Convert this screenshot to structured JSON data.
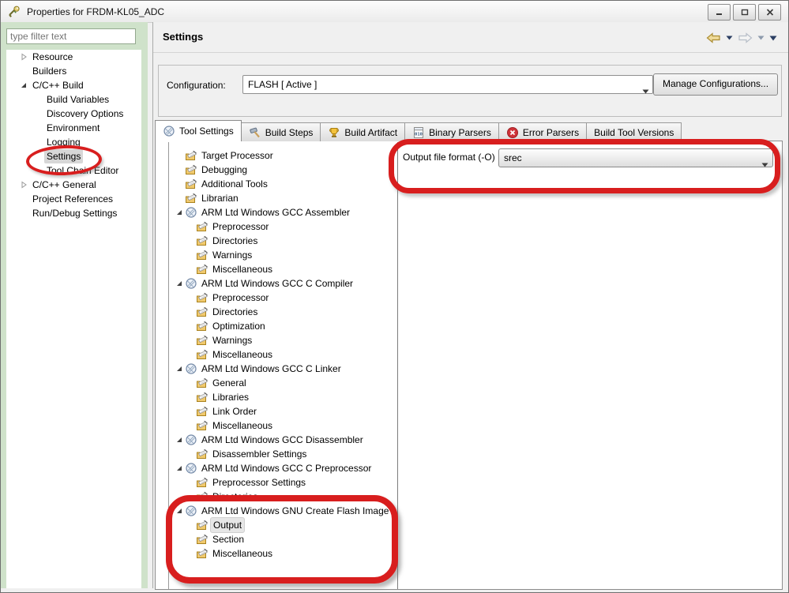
{
  "window": {
    "title": "Properties for FRDM-KL05_ADC"
  },
  "sidebar": {
    "filter_placeholder": "type filter text",
    "items": [
      {
        "label": "Resource",
        "level": 0,
        "arrow": "collapsed"
      },
      {
        "label": "Builders",
        "level": 0,
        "arrow": "none"
      },
      {
        "label": "C/C++ Build",
        "level": 0,
        "arrow": "expanded"
      },
      {
        "label": "Build Variables",
        "level": 1,
        "arrow": "none"
      },
      {
        "label": "Discovery Options",
        "level": 1,
        "arrow": "none"
      },
      {
        "label": "Environment",
        "level": 1,
        "arrow": "none"
      },
      {
        "label": "Logging",
        "level": 1,
        "arrow": "none"
      },
      {
        "label": "Settings",
        "level": 1,
        "arrow": "none",
        "selected": true
      },
      {
        "label": "Tool Chain Editor",
        "level": 1,
        "arrow": "none"
      },
      {
        "label": "C/C++ General",
        "level": 0,
        "arrow": "collapsed"
      },
      {
        "label": "Project References",
        "level": 0,
        "arrow": "none"
      },
      {
        "label": "Run/Debug Settings",
        "level": 0,
        "arrow": "none"
      }
    ]
  },
  "header": {
    "title": "Settings"
  },
  "config": {
    "label": "Configuration:",
    "value": "FLASH  [ Active ]",
    "manage_button": "Manage Configurations..."
  },
  "tabs": [
    {
      "label": "Tool Settings",
      "icon": "tool",
      "active": true
    },
    {
      "label": "Build Steps",
      "icon": "hammer",
      "active": false
    },
    {
      "label": "Build Artifact",
      "icon": "trophy",
      "active": false
    },
    {
      "label": "Binary Parsers",
      "icon": "binary",
      "active": false
    },
    {
      "label": "Error Parsers",
      "icon": "error",
      "active": false
    },
    {
      "label": "Build Tool Versions",
      "icon": "none",
      "active": false
    }
  ],
  "tool_tree": [
    {
      "label": "Target Processor",
      "icon": "category",
      "level": 0,
      "arrow": "none"
    },
    {
      "label": "Debugging",
      "icon": "category",
      "level": 0,
      "arrow": "none"
    },
    {
      "label": "Additional Tools",
      "icon": "category",
      "level": 0,
      "arrow": "none"
    },
    {
      "label": "Librarian",
      "icon": "category",
      "level": 0,
      "arrow": "none"
    },
    {
      "label": "ARM Ltd Windows GCC Assembler",
      "icon": "tool",
      "level": 0,
      "arrow": "expanded"
    },
    {
      "label": "Preprocessor",
      "icon": "category",
      "level": 1,
      "arrow": "none"
    },
    {
      "label": "Directories",
      "icon": "category",
      "level": 1,
      "arrow": "none"
    },
    {
      "label": "Warnings",
      "icon": "category",
      "level": 1,
      "arrow": "none"
    },
    {
      "label": "Miscellaneous",
      "icon": "category",
      "level": 1,
      "arrow": "none"
    },
    {
      "label": "ARM Ltd Windows GCC C Compiler",
      "icon": "tool",
      "level": 0,
      "arrow": "expanded"
    },
    {
      "label": "Preprocessor",
      "icon": "category",
      "level": 1,
      "arrow": "none"
    },
    {
      "label": "Directories",
      "icon": "category",
      "level": 1,
      "arrow": "none"
    },
    {
      "label": "Optimization",
      "icon": "category",
      "level": 1,
      "arrow": "none"
    },
    {
      "label": "Warnings",
      "icon": "category",
      "level": 1,
      "arrow": "none"
    },
    {
      "label": "Miscellaneous",
      "icon": "category",
      "level": 1,
      "arrow": "none"
    },
    {
      "label": "ARM Ltd Windows GCC C Linker",
      "icon": "tool",
      "level": 0,
      "arrow": "expanded"
    },
    {
      "label": "General",
      "icon": "category",
      "level": 1,
      "arrow": "none"
    },
    {
      "label": "Libraries",
      "icon": "category",
      "level": 1,
      "arrow": "none"
    },
    {
      "label": "Link Order",
      "icon": "category",
      "level": 1,
      "arrow": "none"
    },
    {
      "label": "Miscellaneous",
      "icon": "category",
      "level": 1,
      "arrow": "none"
    },
    {
      "label": "ARM Ltd Windows GCC Disassembler",
      "icon": "tool",
      "level": 0,
      "arrow": "expanded"
    },
    {
      "label": "Disassembler Settings",
      "icon": "category",
      "level": 1,
      "arrow": "none"
    },
    {
      "label": "ARM Ltd Windows GCC C Preprocessor",
      "icon": "tool",
      "level": 0,
      "arrow": "expanded"
    },
    {
      "label": "Preprocessor Settings",
      "icon": "category",
      "level": 1,
      "arrow": "none"
    },
    {
      "label": "Directories",
      "icon": "category",
      "level": 1,
      "arrow": "none"
    },
    {
      "label": "ARM Ltd Windows GNU Create Flash Image",
      "icon": "tool",
      "level": 0,
      "arrow": "expanded"
    },
    {
      "label": "Output",
      "icon": "category",
      "level": 1,
      "arrow": "none",
      "selected": true
    },
    {
      "label": "Section",
      "icon": "category",
      "level": 1,
      "arrow": "none"
    },
    {
      "label": "Miscellaneous",
      "icon": "category",
      "level": 1,
      "arrow": "none"
    }
  ],
  "output_panel": {
    "label": "Output file format (-O)",
    "value": "srec"
  },
  "colors": {
    "annotation_red": "#d81e1e",
    "sidebar_green": "#cfe2ca",
    "selection_gray": "#d7d7d7"
  }
}
